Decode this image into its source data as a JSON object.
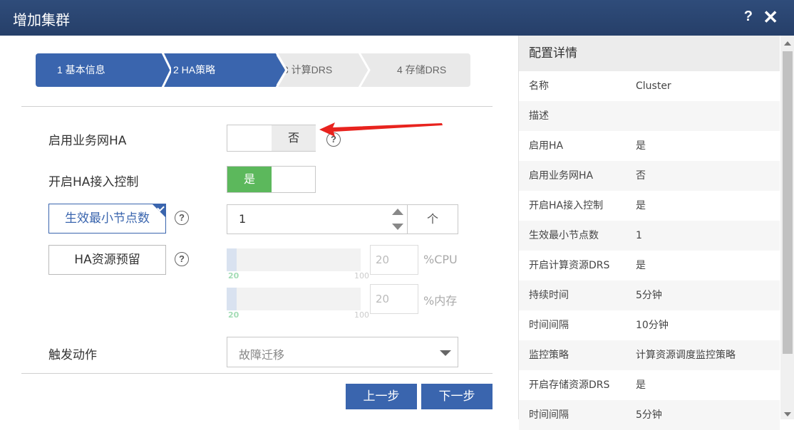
{
  "dialog": {
    "title": "增加集群",
    "help_glyph": "?",
    "close_glyph": "✕"
  },
  "steps": [
    {
      "label": "1 基本信息",
      "state": "done"
    },
    {
      "label": "2 HA策略",
      "state": "active"
    },
    {
      "label": "3 计算DRS",
      "state": "pending"
    },
    {
      "label": "4 存储DRS",
      "state": "pending"
    }
  ],
  "form": {
    "business_ha": {
      "label": "启用业务网HA",
      "value": "否"
    },
    "ha_admission": {
      "label": "开启HA接入控制",
      "value": "是"
    },
    "min_nodes": {
      "label": "生效最小节点数",
      "value": "1",
      "unit": "个"
    },
    "ha_reserve": {
      "label": "HA资源预留",
      "cpu": {
        "value": "20",
        "min": "20",
        "max": "100",
        "unit": "%CPU"
      },
      "mem": {
        "value": "20",
        "min": "20",
        "max": "100",
        "unit": "%内存"
      }
    },
    "trigger_action": {
      "label": "触发动作",
      "value": "故障迁移"
    }
  },
  "buttons": {
    "prev": "上一步",
    "next": "下一步"
  },
  "details": {
    "title": "配置详情",
    "rows": [
      {
        "key": "名称",
        "value": "Cluster"
      },
      {
        "key": "描述",
        "value": ""
      },
      {
        "key": "启用HA",
        "value": "是"
      },
      {
        "key": "启用业务网HA",
        "value": "否"
      },
      {
        "key": "开启HA接入控制",
        "value": "是"
      },
      {
        "key": "生效最小节点数",
        "value": "1"
      },
      {
        "key": "开启计算资源DRS",
        "value": "是"
      },
      {
        "key": "持续时间",
        "value": "5分钟"
      },
      {
        "key": "时间间隔",
        "value": "10分钟"
      },
      {
        "key": "监控策略",
        "value": "计算资源调度监控策略"
      },
      {
        "key": "开启存储资源DRS",
        "value": "是"
      },
      {
        "key": "时间间隔",
        "value": "5分钟"
      }
    ]
  },
  "colors": {
    "accent": "#3a65ae",
    "toggle_on": "#5cb85c",
    "title_bar": "#2b4673",
    "annotation_arrow": "#e8231e"
  },
  "icons": [
    "help-icon",
    "close-icon",
    "question-icon",
    "spinner-up-icon",
    "spinner-down-icon",
    "dropdown-caret-icon",
    "check-corner-icon"
  ]
}
